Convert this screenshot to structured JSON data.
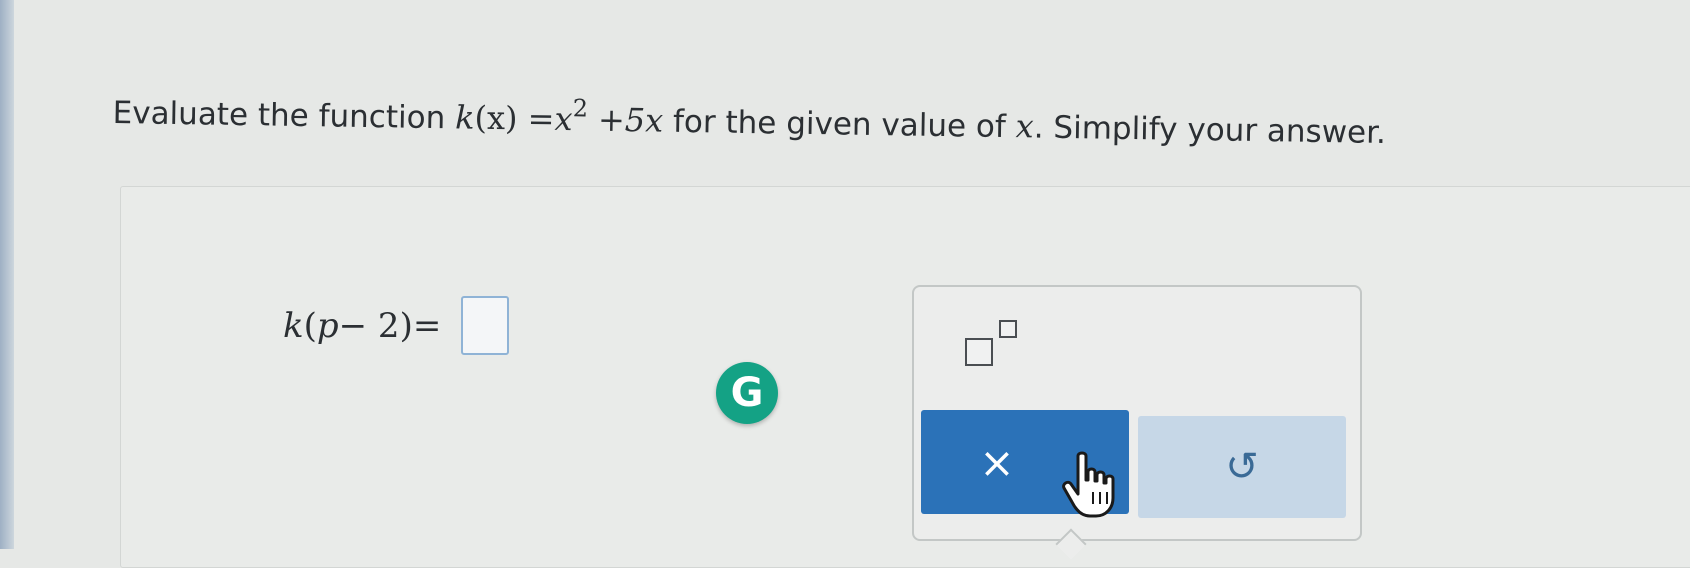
{
  "question": {
    "prefix": "Evaluate the function ",
    "func_name": "k",
    "func_arg": "(x)",
    "equals": "=",
    "var": "x",
    "exponent": "2",
    "plus_term": "+5x",
    "suffix": " for the given value of ",
    "value_var": "x",
    "end": ". Simplify your answer."
  },
  "equation": {
    "func": "k",
    "open": "(",
    "var": "p",
    "minus": " − 2",
    "close": ")",
    "equals": " ="
  },
  "answer": {
    "value": ""
  },
  "grammarly": {
    "letter": "G"
  },
  "palette": {
    "clear_label": "×",
    "undo_label": "↺"
  },
  "colors": {
    "clear_button": "#2b72b8",
    "undo_button": "#c6d7e7",
    "grammarly": "#14a285",
    "answer_border": "#8fb3d6"
  }
}
